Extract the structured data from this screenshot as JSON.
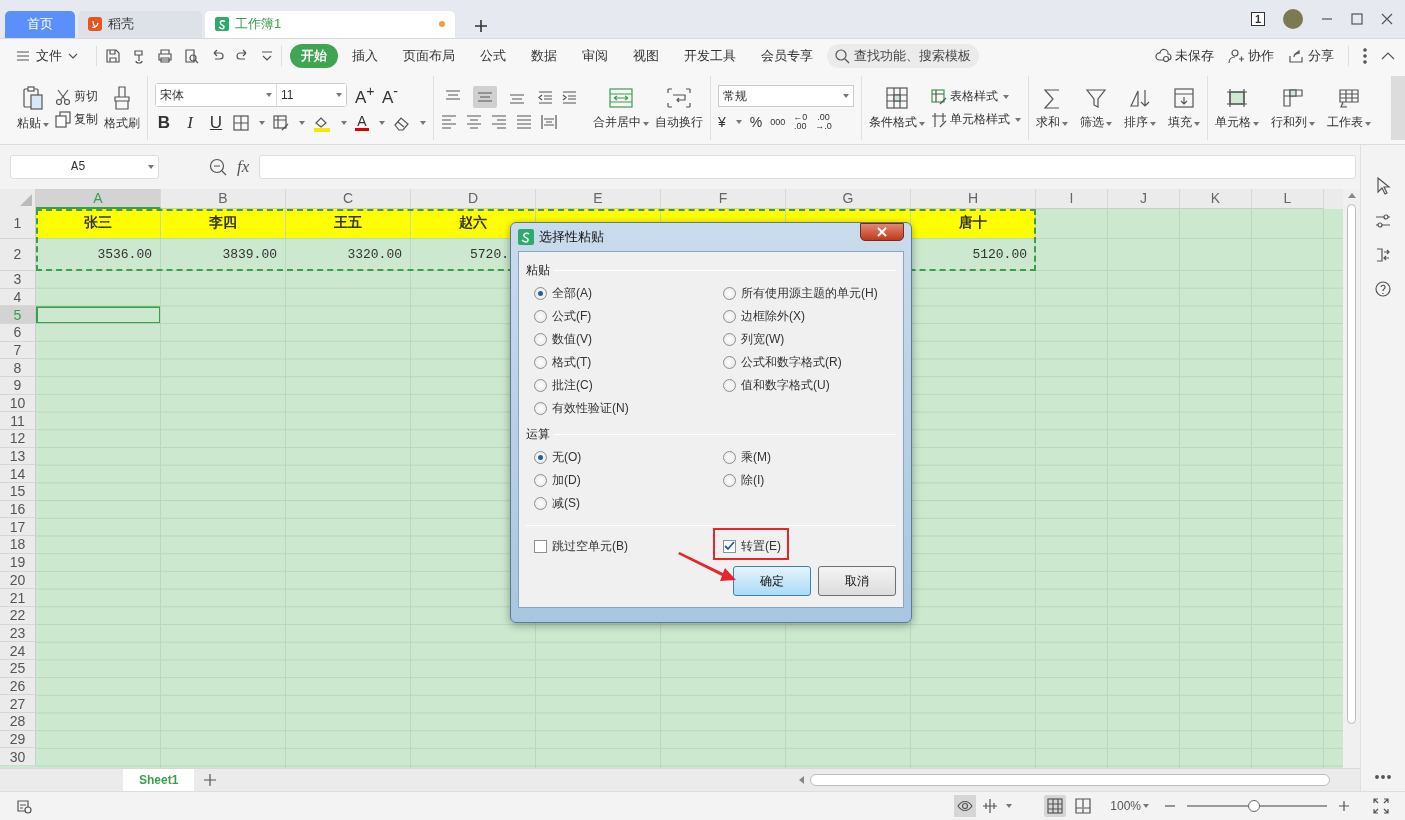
{
  "title_tabs": [
    {
      "label": "首页",
      "kind": "home",
      "selected": false
    },
    {
      "label": "稻壳",
      "kind": "docer",
      "selected": false
    },
    {
      "label": "工作簿1",
      "kind": "sheet",
      "selected": true,
      "unsaved": true
    }
  ],
  "window_badge": "1",
  "menu": {
    "file": "文件",
    "tabs": [
      {
        "label": "开始",
        "selected": true
      },
      {
        "label": "插入",
        "selected": false
      },
      {
        "label": "页面布局",
        "selected": false
      },
      {
        "label": "公式",
        "selected": false
      },
      {
        "label": "数据",
        "selected": false
      },
      {
        "label": "审阅",
        "selected": false
      },
      {
        "label": "视图",
        "selected": false
      },
      {
        "label": "开发工具",
        "selected": false
      },
      {
        "label": "会员专享",
        "selected": false
      }
    ],
    "search": {
      "placeholder": "查找功能、搜索模板"
    },
    "actions": [
      {
        "label": "未保存",
        "kind": "cloud"
      },
      {
        "label": "协作",
        "kind": "people"
      },
      {
        "label": "分享",
        "kind": "share"
      }
    ]
  },
  "ribbon": {
    "paste": "粘贴",
    "cut": "剪切",
    "copy": "复制",
    "format_painter": "格式刷",
    "font_name": "宋体",
    "font_size": "11",
    "grow_font": "A$^{+}$",
    "shrink_font": "A$^{-}$",
    "styles": [
      {
        "label": "B",
        "kind": "bold"
      },
      {
        "label": "I",
        "kind": "italic"
      },
      {
        "label": "U",
        "kind": "underline"
      }
    ],
    "font_color": "A",
    "vertical_align": [
      {
        "kind": "top",
        "selected": false
      },
      {
        "kind": "middle",
        "selected": true
      },
      {
        "kind": "bottom",
        "selected": false
      }
    ],
    "merge": "合并居中",
    "wrap": "自动换行",
    "number_format": "常规",
    "currency": "¥",
    "percent": "%",
    "thousands": "000",
    "decimal_buttons": [
      "←0\n.00",
      ".00\n→.0"
    ],
    "conditional_format": "条件格式",
    "table_style": "表格样式",
    "cell_style": "单元格样式",
    "tools": [
      {
        "label": "求和",
        "kind": "sum"
      },
      {
        "label": "筛选",
        "kind": "filter"
      },
      {
        "label": "排序",
        "kind": "sort"
      },
      {
        "label": "填充",
        "kind": "fill"
      }
    ],
    "cell_tools": [
      {
        "label": "单元格",
        "kind": "cell"
      },
      {
        "label": "行和列",
        "kind": "rowcol"
      },
      {
        "label": "工作表",
        "kind": "sheet"
      }
    ]
  },
  "formula_bar": {
    "cell_ref": "A5",
    "fx": "fx"
  },
  "sheet": {
    "columns": [
      {
        "label": "A",
        "selected": true
      },
      {
        "label": "B",
        "selected": false
      },
      {
        "label": "C",
        "selected": false
      },
      {
        "label": "D",
        "selected": false
      },
      {
        "label": "E",
        "selected": false
      },
      {
        "label": "F",
        "selected": false
      },
      {
        "label": "G",
        "selected": false
      },
      {
        "label": "H",
        "selected": false
      },
      {
        "label": "I",
        "selected": false
      },
      {
        "label": "J",
        "selected": false
      },
      {
        "label": "K",
        "selected": false
      },
      {
        "label": "L",
        "selected": false
      }
    ],
    "rows": [
      {
        "number": "1",
        "kind": "header",
        "copied": true,
        "selected": false,
        "cells": [
          "张三",
          "李四",
          "王五",
          "赵六",
          null,
          null,
          null,
          "唐十"
        ]
      },
      {
        "number": "2",
        "kind": "values",
        "copied": true,
        "selected": false,
        "cells": [
          "3536.00",
          "3839.00",
          "3320.00",
          "5720.",
          null,
          null,
          null,
          "5120.00"
        ]
      },
      {
        "number": "3",
        "selected": false
      },
      {
        "number": "4",
        "selected": false
      },
      {
        "number": "5",
        "selected": true
      },
      {
        "number": "6",
        "selected": false
      },
      {
        "number": "7",
        "selected": false
      },
      {
        "number": "8",
        "selected": false
      },
      {
        "number": "9",
        "selected": false
      },
      {
        "number": "10",
        "selected": false
      },
      {
        "number": "11",
        "selected": false
      },
      {
        "number": "12",
        "selected": false
      },
      {
        "number": "13",
        "selected": false
      },
      {
        "number": "14",
        "selected": false
      },
      {
        "number": "15",
        "selected": false
      },
      {
        "number": "16",
        "selected": false
      },
      {
        "number": "17",
        "selected": false
      },
      {
        "number": "18",
        "selected": false
      },
      {
        "number": "19",
        "selected": false
      },
      {
        "number": "20",
        "selected": false
      },
      {
        "number": "21",
        "selected": false
      },
      {
        "number": "22",
        "selected": false
      },
      {
        "number": "23",
        "selected": false
      },
      {
        "number": "24",
        "selected": false
      },
      {
        "number": "25",
        "selected": false
      },
      {
        "number": "26",
        "selected": false
      },
      {
        "number": "27",
        "selected": false
      },
      {
        "number": "28",
        "selected": false
      },
      {
        "number": "29",
        "selected": false
      },
      {
        "number": "30",
        "selected": false
      }
    ]
  },
  "sheet_tabs": [
    {
      "label": "Sheet1",
      "selected": true
    }
  ],
  "status_bar": {
    "views": [
      {
        "kind": "normal",
        "selected": true
      },
      {
        "kind": "page",
        "selected": false
      }
    ],
    "zoom": "100%",
    "zoom_slider": {
      "level": 0.48
    }
  },
  "dialog": {
    "title": "选择性粘贴",
    "groups": [
      {
        "label": "粘贴",
        "columns": [
          [
            {
              "label": "全部(A)",
              "selected": true
            },
            {
              "label": "公式(F)",
              "selected": false
            },
            {
              "label": "数值(V)",
              "selected": false
            },
            {
              "label": "格式(T)",
              "selected": false
            },
            {
              "label": "批注(C)",
              "selected": false
            },
            {
              "label": "有效性验证(N)",
              "selected": false
            }
          ],
          [
            {
              "label": "所有使用源主题的单元(H)",
              "selected": false
            },
            {
              "label": "边框除外(X)",
              "selected": false
            },
            {
              "label": "列宽(W)",
              "selected": false
            },
            {
              "label": "公式和数字格式(R)",
              "selected": false
            },
            {
              "label": "值和数字格式(U)",
              "selected": false
            }
          ]
        ]
      },
      {
        "label": "运算",
        "columns": [
          [
            {
              "label": "无(O)",
              "selected": true
            },
            {
              "label": "加(D)",
              "selected": false
            },
            {
              "label": "减(S)",
              "selected": false
            }
          ],
          [
            {
              "label": "乘(M)",
              "selected": false
            },
            {
              "label": "除(I)",
              "selected": false
            }
          ]
        ]
      }
    ],
    "checkboxes": [
      {
        "label": "跳过空单元(B)",
        "checked": false,
        "highlighted": false
      },
      {
        "label": "转置(E)",
        "checked": true,
        "highlighted": true
      }
    ],
    "buttons": [
      {
        "label": "确定",
        "kind": "primary"
      },
      {
        "label": "取消",
        "kind": "normal"
      }
    ]
  }
}
